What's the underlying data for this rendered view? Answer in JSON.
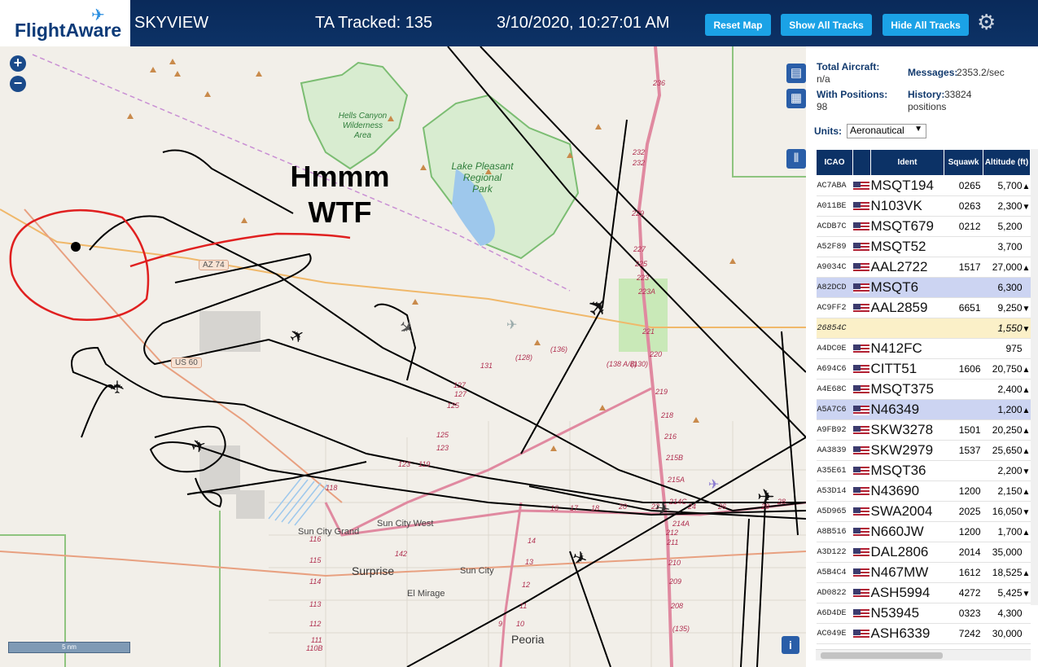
{
  "header": {
    "logo_text": "FlightAware",
    "app_title": "SKYVIEW",
    "tracked_label": "TA Tracked: 135",
    "datetime": "3/10/2020, 10:27:01 AM",
    "buttons": {
      "reset_map": "Reset Map",
      "show_all": "Show All Tracks",
      "hide_all": "Hide All Tracks"
    },
    "settings_icon": "gear-icon"
  },
  "map": {
    "zoom_in": "+",
    "zoom_out": "−",
    "annotation_line1": "Hmmm",
    "annotation_line2": "WTF",
    "scale_label": "5 nm",
    "places": {
      "sun_city_grand": "Sun City Grand",
      "sun_city_west": "Sun City West",
      "surprise": "Surprise",
      "sun_city": "Sun City",
      "el_mirage": "El Mirage",
      "peoria": "Peoria"
    },
    "parks": {
      "hells_canyon": [
        "Hells Canyon",
        "Wilderness",
        "Area"
      ],
      "lake_pleasant": [
        "Lake Pleasant",
        "Regional",
        "Park"
      ]
    },
    "highways": {
      "az74": "AZ 74",
      "us60": "US 60"
    },
    "road_numbers": [
      "236",
      "232",
      "232",
      "229",
      "227",
      "225",
      "223",
      "223A",
      "221",
      "220",
      "219",
      "218",
      "216",
      "215B",
      "215A",
      "214C",
      "214A",
      "212",
      "211",
      "210",
      "209",
      "208",
      "(135)",
      "(136)",
      "(138 A/B)",
      "(130)",
      "131",
      "(128)",
      "127",
      "127",
      "125",
      "125",
      "123",
      "123",
      "119",
      "118",
      "116",
      "115",
      "114",
      "113",
      "112",
      "111",
      "110B",
      "142",
      "14",
      "13",
      "12",
      "11",
      "10",
      "9",
      "16",
      "17",
      "18",
      "20",
      "22",
      "24",
      "26",
      "28",
      "28"
    ]
  },
  "panel": {
    "total_aircraft_label": "Total Aircraft:",
    "total_aircraft_value": "n/a",
    "messages_label": "Messages:",
    "messages_value": "2353.2/sec",
    "with_positions_label": "With Positions:",
    "with_positions_value": "98",
    "history_label": "History:",
    "history_value": "33824",
    "history_unit": "positions",
    "units_label": "Units:",
    "units_value": "Aeronautical",
    "columns": {
      "icao": "ICAO",
      "ident": "Ident",
      "squawk": "Squawk",
      "altitude": "Altitude (ft)"
    },
    "rows": [
      {
        "icao": "AC7ABA",
        "ident": "MSQT194",
        "squawk": "0265",
        "alt": "5,700",
        "trend": "▲"
      },
      {
        "icao": "A011BE",
        "ident": "N103VK",
        "squawk": "0263",
        "alt": "2,300",
        "trend": "▼"
      },
      {
        "icao": "ACDB7C",
        "ident": "MSQT679",
        "squawk": "0212",
        "alt": "5,200",
        "trend": ""
      },
      {
        "icao": "A52F89",
        "ident": "MSQT52",
        "squawk": "",
        "alt": "3,700",
        "trend": ""
      },
      {
        "icao": "A9034C",
        "ident": "AAL2722",
        "squawk": "1517",
        "alt": "27,000",
        "trend": "▲"
      },
      {
        "icao": "A82DCD",
        "ident": "MSQT6",
        "squawk": "",
        "alt": "6,300",
        "trend": ""
      },
      {
        "icao": "AC9FF2",
        "ident": "AAL2859",
        "squawk": "6651",
        "alt": "9,250",
        "trend": "▼"
      },
      {
        "icao": "26854C",
        "ident": "",
        "squawk": "",
        "alt": "1,550",
        "trend": "▼"
      },
      {
        "icao": "A4DC0E",
        "ident": "N412FC",
        "squawk": "",
        "alt": "975",
        "trend": ""
      },
      {
        "icao": "A694C6",
        "ident": "CITT51",
        "squawk": "1606",
        "alt": "20,750",
        "trend": "▲"
      },
      {
        "icao": "A4E68C",
        "ident": "MSQT375",
        "squawk": "",
        "alt": "2,400",
        "trend": "▲"
      },
      {
        "icao": "A5A7C6",
        "ident": "N46349",
        "squawk": "",
        "alt": "1,200",
        "trend": "▲"
      },
      {
        "icao": "A9FB92",
        "ident": "SKW3278",
        "squawk": "1501",
        "alt": "20,250",
        "trend": "▲"
      },
      {
        "icao": "AA3839",
        "ident": "SKW2979",
        "squawk": "1537",
        "alt": "25,650",
        "trend": "▲"
      },
      {
        "icao": "A35E61",
        "ident": "MSQT36",
        "squawk": "",
        "alt": "2,200",
        "trend": "▼"
      },
      {
        "icao": "A53D14",
        "ident": "N43690",
        "squawk": "1200",
        "alt": "2,150",
        "trend": "▲"
      },
      {
        "icao": "A5D965",
        "ident": "SWA2004",
        "squawk": "2025",
        "alt": "16,050",
        "trend": "▼"
      },
      {
        "icao": "A8B516",
        "ident": "N660JW",
        "squawk": "1200",
        "alt": "1,700",
        "trend": "▲"
      },
      {
        "icao": "A3D122",
        "ident": "DAL2806",
        "squawk": "2014",
        "alt": "35,000",
        "trend": ""
      },
      {
        "icao": "A5B4C4",
        "ident": "N467MW",
        "squawk": "1612",
        "alt": "18,525",
        "trend": "▲"
      },
      {
        "icao": "AD0822",
        "ident": "ASH5994",
        "squawk": "4272",
        "alt": "5,425",
        "trend": "▼"
      },
      {
        "icao": "A6D4DE",
        "ident": "N53945",
        "squawk": "0323",
        "alt": "4,300",
        "trend": ""
      },
      {
        "icao": "AC049E",
        "ident": "ASH6339",
        "squawk": "7242",
        "alt": "30,000",
        "trend": ""
      }
    ],
    "row_states": [
      "",
      "",
      "",
      "",
      "",
      "sel",
      "",
      "noloc",
      "",
      "",
      "",
      "sel",
      "",
      "",
      "",
      "",
      "",
      "",
      "",
      "",
      "",
      "",
      ""
    ]
  }
}
